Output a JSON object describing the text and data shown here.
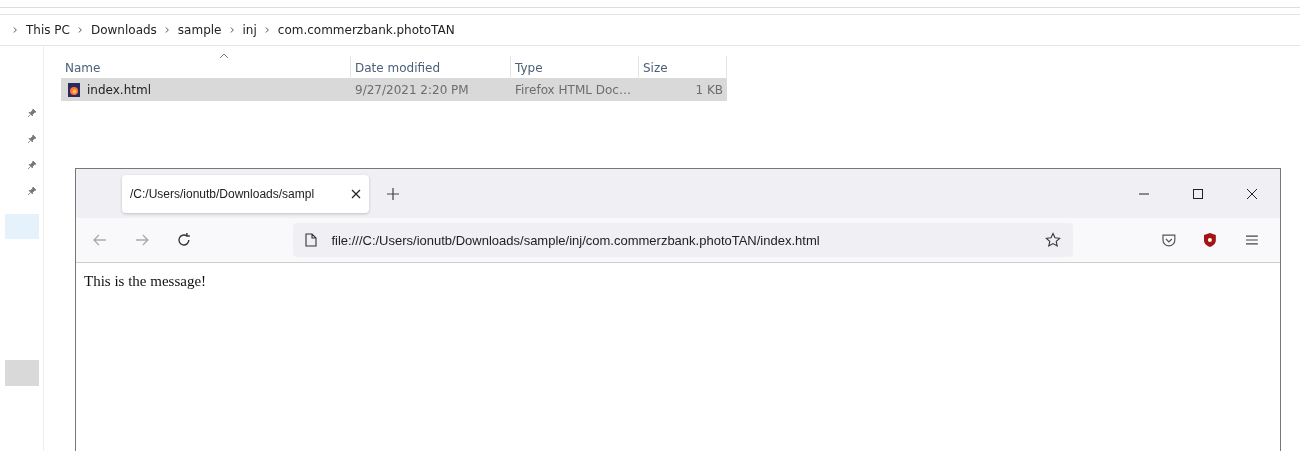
{
  "explorer": {
    "breadcrumb": [
      "This PC",
      "Downloads",
      "sample",
      "inj",
      "com.commerzbank.photoTAN"
    ],
    "columns": [
      {
        "label": "Name",
        "sorted": true
      },
      {
        "label": "Date modified",
        "sorted": false
      },
      {
        "label": "Type",
        "sorted": false
      },
      {
        "label": "Size",
        "sorted": false
      }
    ],
    "files": [
      {
        "name": "index.html",
        "date": "9/27/2021 2:20 PM",
        "type": "Firefox HTML Doc…",
        "size": "1 KB",
        "selected": true
      }
    ]
  },
  "browser": {
    "tabs": [
      {
        "title": "/C:/Users/ionutb/Downloads/sampl",
        "selected": true
      }
    ],
    "url": "file:///C:/Users/ionutb/Downloads/sample/inj/com.commerzbank.photoTAN/index.html",
    "page_text": "This is the message!"
  }
}
